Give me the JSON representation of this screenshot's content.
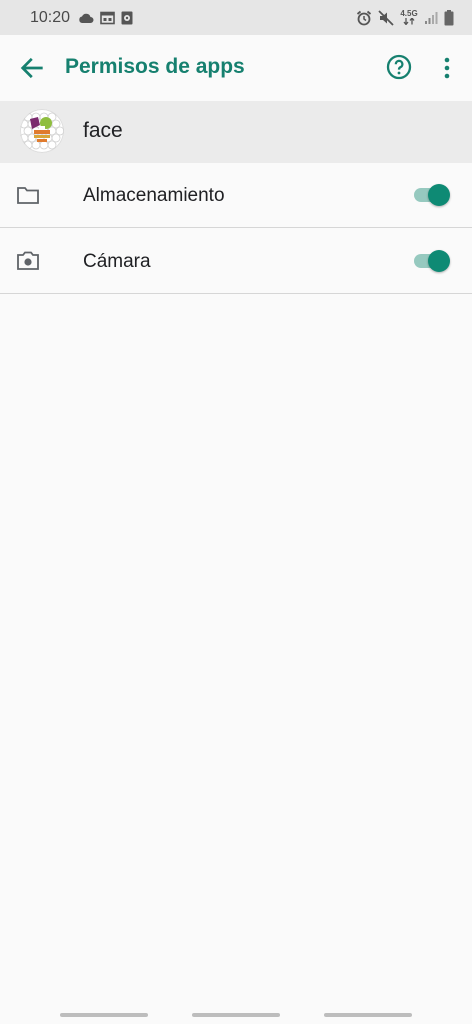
{
  "status_bar": {
    "time": "10:20",
    "network_label": "4.5G",
    "icons": [
      "cloud-icon",
      "calendar-icon",
      "storage-icon",
      "alarm-icon",
      "mute-icon",
      "network-icon",
      "signal-icon",
      "battery-icon"
    ]
  },
  "app_bar": {
    "title": "Permisos de apps",
    "accent_color": "#16806f"
  },
  "app": {
    "name": "face"
  },
  "permissions": [
    {
      "label": "Almacenamiento",
      "icon": "folder-icon",
      "enabled": true
    },
    {
      "label": "Cámara",
      "icon": "camera-icon",
      "enabled": true
    }
  ],
  "colors": {
    "toggle_thumb": "#0e8a74",
    "toggle_track": "#96c9bf"
  }
}
